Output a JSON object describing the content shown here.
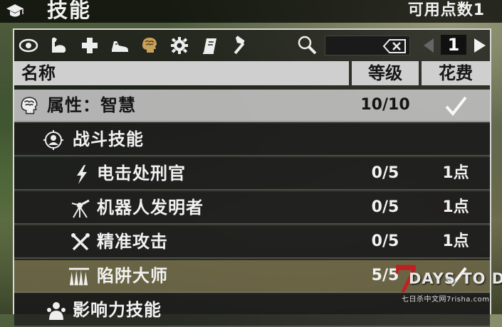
{
  "header": {
    "title": "技能",
    "points_label": "可用点数1",
    "icon": "graduation-cap-icon"
  },
  "toolbar": {
    "categories": [
      {
        "icon": "eye-icon",
        "active": false
      },
      {
        "icon": "bicep-icon",
        "active": false
      },
      {
        "icon": "plus-icon",
        "active": false
      },
      {
        "icon": "running-shoe-icon",
        "active": false
      },
      {
        "icon": "brain-head-icon",
        "active": true
      },
      {
        "icon": "gear-icon",
        "active": false
      },
      {
        "icon": "book-icon",
        "active": false
      },
      {
        "icon": "hammer-icon",
        "active": false
      }
    ],
    "search_value": "",
    "search_icon": "search-icon",
    "clear_icon": "backspace-icon",
    "page": "1"
  },
  "columns": {
    "name": "名称",
    "level": "等级",
    "cost": "花费"
  },
  "rows": [
    {
      "name": "属性：智慧",
      "level": "10/10",
      "cost": "",
      "icon": "brain-head-icon",
      "status": "check-icon"
    },
    {
      "name": "战斗技能",
      "level": "",
      "cost": "",
      "icon": "crosshair-person-icon"
    },
    {
      "name": "电击处刑官",
      "level": "0/5",
      "cost": "1点",
      "icon": "lightning-icon"
    },
    {
      "name": "机器人发明者",
      "level": "0/5",
      "cost": "1点",
      "icon": "robot-turret-icon"
    },
    {
      "name": "精准攻击",
      "level": "0/5",
      "cost": "1点",
      "icon": "crossed-tools-icon"
    },
    {
      "name": "陷阱大师",
      "level": "5/5",
      "cost": "",
      "icon": "spike-trap-icon",
      "status": "check-icon"
    },
    {
      "name": "影响力技能",
      "level": "",
      "cost": "",
      "icon": "people-icon"
    }
  ],
  "logo": {
    "number": "7",
    "brand": "DAYS TO DIE",
    "site": "七日杀中文网7risha.com"
  },
  "colors": {
    "selected_row": "#cdcdcd",
    "highlight_row": "#a0966a",
    "row_bg": "#1e1e1e",
    "logo_red": "#c02020"
  }
}
